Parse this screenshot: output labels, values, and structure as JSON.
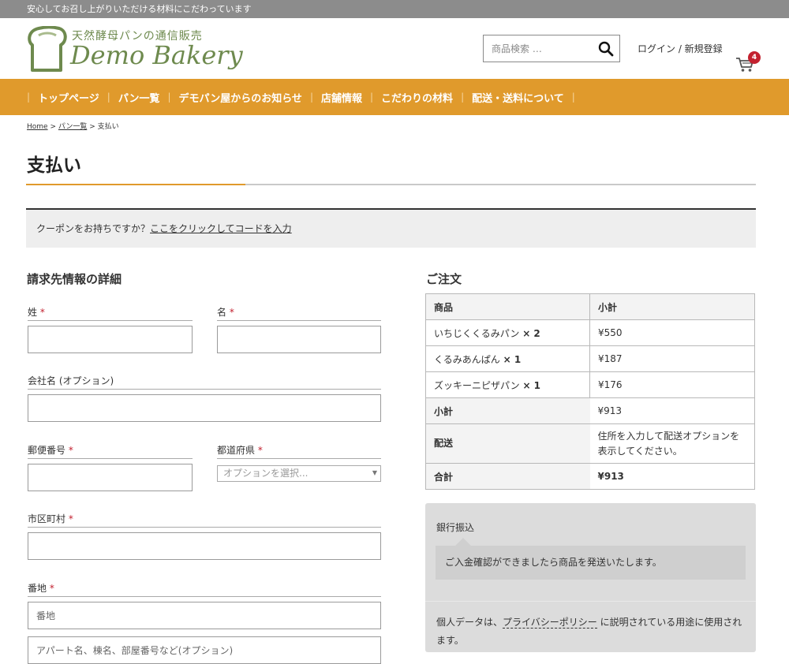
{
  "topbar": {
    "message": "安心してお召し上がりいただける材料にこだわっています"
  },
  "header": {
    "logo_sub": "天然酵母パンの通信販売",
    "logo_main": "Demo Bakery",
    "search_placeholder": "商品検索 …",
    "login_label": "ログイン / 新規登録",
    "cart_count": "4"
  },
  "nav": {
    "items": [
      {
        "label": "トップページ"
      },
      {
        "label": "パン一覧"
      },
      {
        "label": "デモパン屋からのお知らせ"
      },
      {
        "label": "店舗情報"
      },
      {
        "label": "こだわりの材料"
      },
      {
        "label": "配送・送料について"
      }
    ]
  },
  "breadcrumb": {
    "home": "Home",
    "sep": ">",
    "list": "パン一覧",
    "current": "支払い"
  },
  "page": {
    "title": "支払い"
  },
  "coupon": {
    "text": "クーポンをお持ちですか？",
    "link": "ここをクリックしてコードを入力"
  },
  "billing": {
    "title": "請求先情報の詳細",
    "last_name": "姓",
    "first_name": "名",
    "company": "会社名 (オプション)",
    "postcode": "郵便番号",
    "prefecture": "都道府県",
    "prefecture_placeholder": "オプションを選択...",
    "city": "市区町村",
    "address": "番地",
    "address_placeholder": "番地",
    "address2_placeholder": "アパート名、棟名、部屋番号など(オプション)",
    "required_mark": "*"
  },
  "order": {
    "title": "ご注文",
    "col_product": "商品",
    "col_subtotal": "小計",
    "items": [
      {
        "name": "いちじくくるみパン",
        "qty": "× 2",
        "price": "¥550"
      },
      {
        "name": "くるみあんぱん",
        "qty": "× 1",
        "price": "¥187"
      },
      {
        "name": "ズッキーニピザパン",
        "qty": "× 1",
        "price": "¥176"
      }
    ],
    "subtotal_label": "小計",
    "subtotal_value": "¥913",
    "shipping_label": "配送",
    "shipping_value": "住所を入力して配送オプションを表示してください。",
    "total_label": "合計",
    "total_value": "¥913"
  },
  "payment": {
    "method": "銀行振込",
    "description": "ご入金確認ができましたら商品を発送いたします。",
    "privacy_before": "個人データは、",
    "privacy_link": "プライバシーポリシー",
    "privacy_after": " に説明されている用途に使用されます。"
  },
  "colors": {
    "accent": "#e09a2c",
    "logo_green": "#6e8a4e",
    "badge_red": "#c3212f"
  }
}
